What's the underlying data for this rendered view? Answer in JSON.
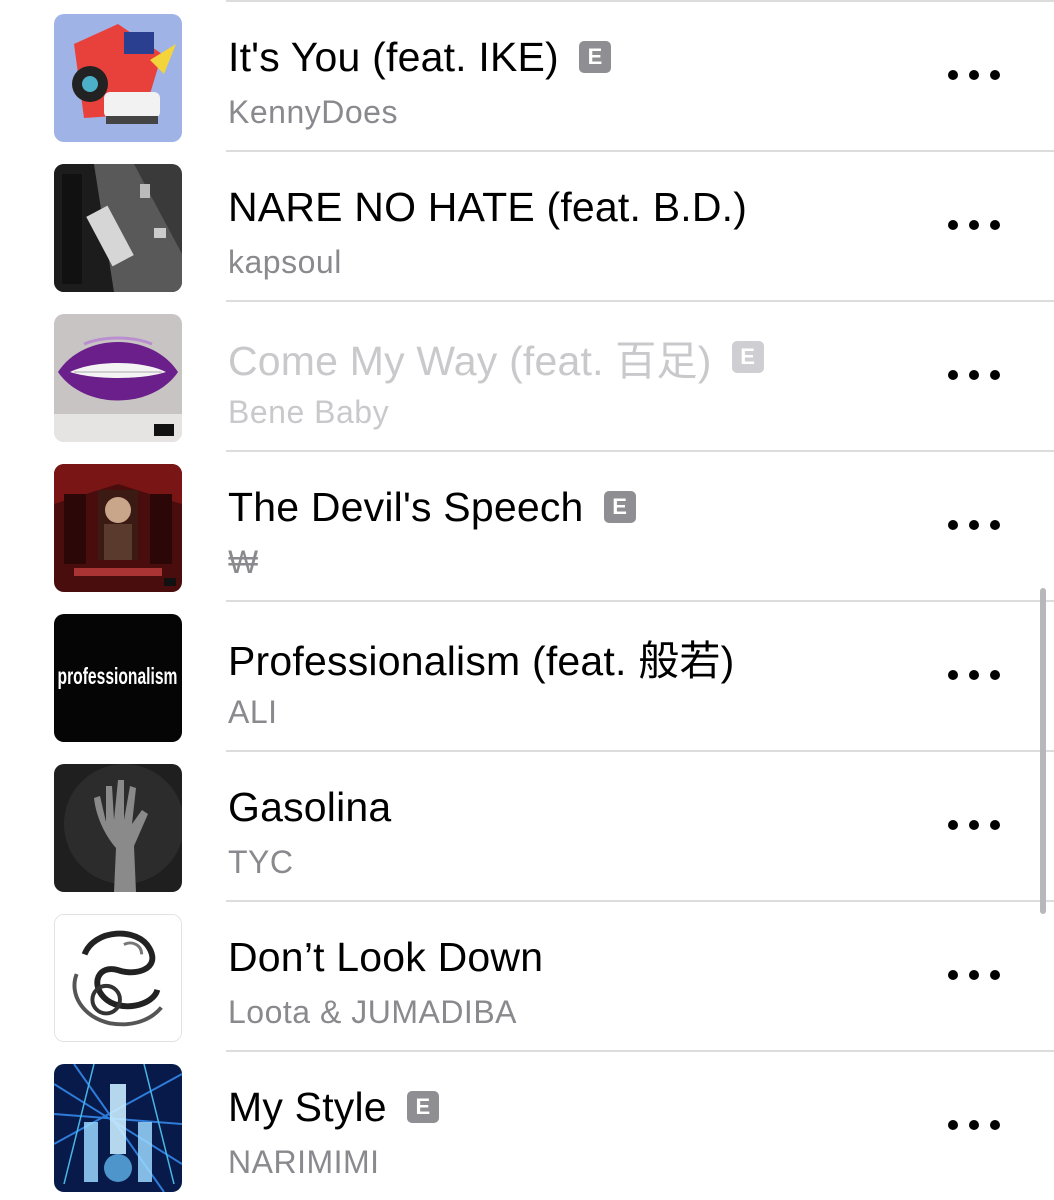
{
  "explicit_badge": "E",
  "tracks": [
    {
      "title": "It's You (feat. IKE)",
      "artist": "KennyDoes",
      "explicit": true,
      "dimmed": false,
      "artwork_icon": "album-art"
    },
    {
      "title": "NARE NO HATE (feat. B.D.)",
      "artist": "kapsoul",
      "explicit": false,
      "dimmed": false,
      "artwork_icon": "album-art"
    },
    {
      "title": "Come My Way (feat. 百足)",
      "artist": "Bene Baby",
      "explicit": true,
      "dimmed": true,
      "artwork_icon": "album-art"
    },
    {
      "title": "The Devil's Speech",
      "artist": "₩",
      "explicit": true,
      "dimmed": false,
      "artwork_icon": "album-art"
    },
    {
      "title": "Professionalism (feat. 般若)",
      "artist": "ALI",
      "explicit": false,
      "dimmed": false,
      "artwork_icon": "album-art",
      "artwork_text": "professionalism"
    },
    {
      "title": "Gasolina",
      "artist": "TYC",
      "explicit": false,
      "dimmed": false,
      "artwork_icon": "album-art"
    },
    {
      "title": "Don’t Look Down",
      "artist": "Loota & JUMADIBA",
      "explicit": false,
      "dimmed": false,
      "artwork_icon": "album-art"
    },
    {
      "title": "My Style",
      "artist": "NARIMIMI",
      "explicit": true,
      "dimmed": false,
      "artwork_icon": "album-art"
    }
  ],
  "more_icon": "more-ellipsis-icon",
  "colors": {
    "title": "#000000",
    "artist": "#8a8a8e",
    "dimmed_text": "#c9c9cc",
    "badge": "#8e8e93",
    "separator": "#dcdcdc"
  }
}
